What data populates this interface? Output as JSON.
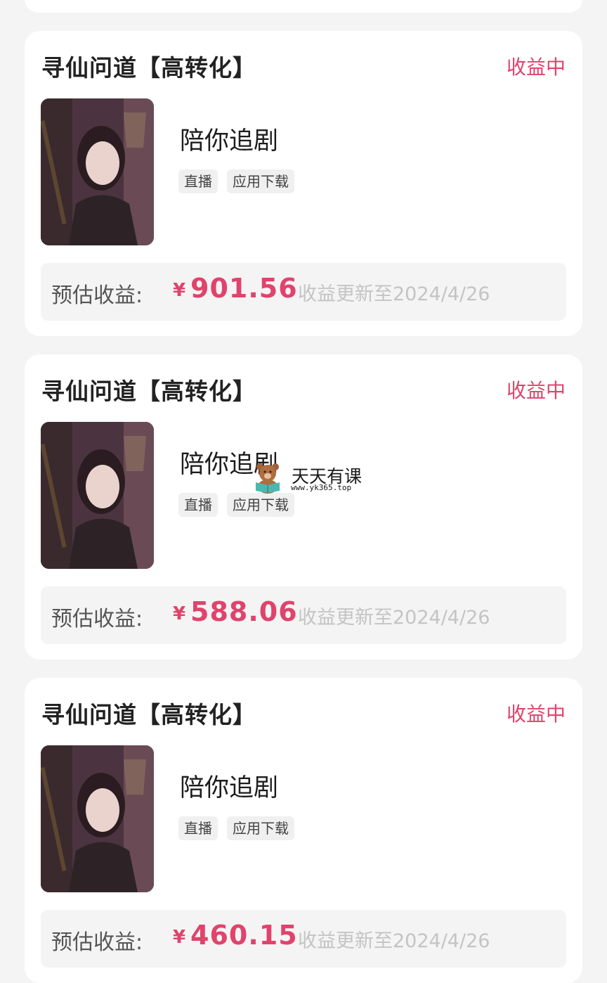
{
  "cards": [
    {
      "title": "寻仙问道【高转化】",
      "status": "收益中",
      "drama_name": "陪你追剧",
      "tags": [
        "直播",
        "应用下载"
      ],
      "earnings_label": "预估收益:",
      "currency": "¥",
      "earnings_value": "901.56",
      "update_text": "收益更新至2024/4/26"
    },
    {
      "title": "寻仙问道【高转化】",
      "status": "收益中",
      "drama_name": "陪你追剧",
      "tags": [
        "直播",
        "应用下载"
      ],
      "earnings_label": "预估收益:",
      "currency": "¥",
      "earnings_value": "588.06",
      "update_text": "收益更新至2024/4/26"
    },
    {
      "title": "寻仙问道【高转化】",
      "status": "收益中",
      "drama_name": "陪你追剧",
      "tags": [
        "直播",
        "应用下载"
      ],
      "earnings_label": "预估收益:",
      "currency": "¥",
      "earnings_value": "460.15",
      "update_text": "收益更新至2024/4/26"
    }
  ],
  "watermark": {
    "title": "天天有课",
    "url": "www.yk365.top"
  },
  "colors": {
    "accent": "#e0436b",
    "background": "#f4f4f5",
    "card": "#ffffff"
  }
}
